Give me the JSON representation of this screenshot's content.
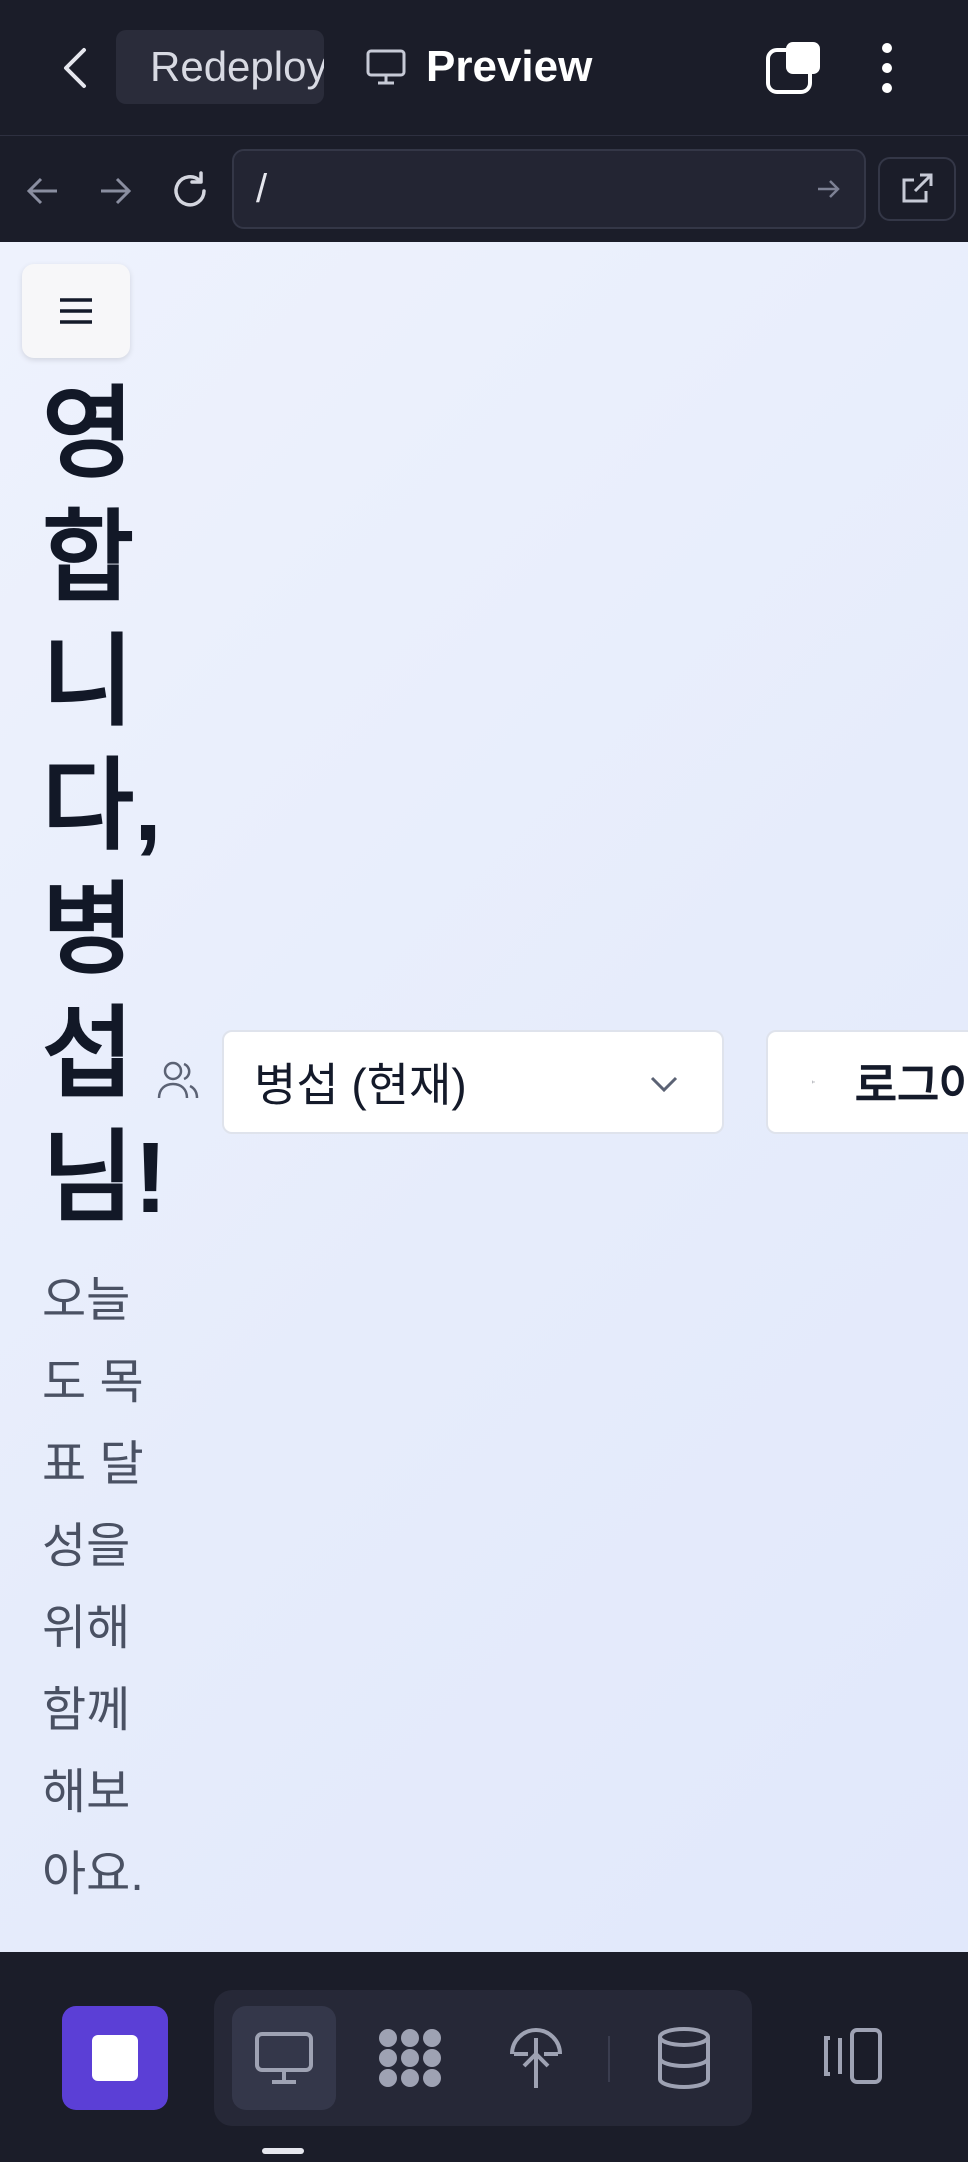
{
  "topbar": {
    "tab_label": "Redeploy",
    "preview_label": "Preview",
    "icons": [
      "chevron-left-icon",
      "sprout-icon",
      "monitor-icon",
      "windows-icon",
      "more-vertical-icon"
    ]
  },
  "browser": {
    "url_path": "/",
    "icons": [
      "arrow-left-icon",
      "arrow-right-icon",
      "reload-icon",
      "arrow-right-small-icon",
      "external-link-icon"
    ]
  },
  "page": {
    "heading": "영합니다, 병섭님!",
    "subtitle": "오늘도 목표 달성을 위해 함께 해보아요.",
    "user_select_value": "병섭 (현재)",
    "logout_label": "로그아웃"
  },
  "dock": {
    "items": [
      "stop-icon",
      "monitor-icon",
      "nodes-icon",
      "deploy-icon",
      "database-icon",
      "panels-icon"
    ]
  },
  "colors": {
    "bar_bg": "#1b1d29",
    "accent": "#5b3fd6",
    "content_bg": "#e9eefc",
    "heading": "#121827"
  }
}
